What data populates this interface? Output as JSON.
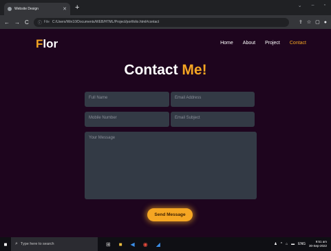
{
  "browser": {
    "tab_title": "Website Design",
    "url_label": "File",
    "url": "C:/Users/Win10/Documents/WEB/HTML/Project/portfolio.html#contact"
  },
  "site": {
    "logo_accent": "F",
    "logo_rest": "lor",
    "nav": [
      "Home",
      "About",
      "Project",
      "Contact"
    ],
    "active_nav": "Contact"
  },
  "contact": {
    "heading_main": "Contact",
    "heading_accent": "Me!",
    "full_name_placeholder": "Full Name",
    "email_placeholder": "Email Address",
    "mobile_placeholder": "Mobile Number",
    "subject_placeholder": "Email Subject",
    "message_placeholder": "Your Message",
    "send_label": "Send Message"
  },
  "taskbar": {
    "search_placeholder": "Type here to search",
    "lang": "ENG",
    "time": "9:51 am",
    "date": "30-Sep-2022"
  },
  "colors": {
    "accent": "#f5a623",
    "page_bg": "#1e051e",
    "field_bg": "#333a45"
  }
}
